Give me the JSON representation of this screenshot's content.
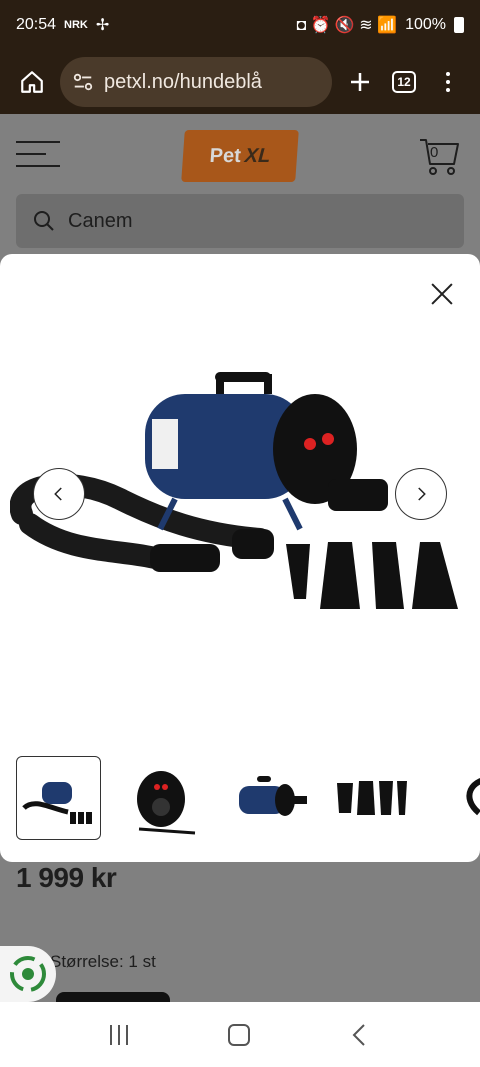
{
  "status": {
    "time": "20:54",
    "carrier": "NRK",
    "battery": "100%"
  },
  "browser": {
    "url": "petxl.no/hundeblå",
    "tabs_count": "12"
  },
  "site": {
    "logo_pet": "Pet",
    "logo_xl": "XL",
    "cart_count": "0",
    "search_value": "Canem",
    "price": "1 999 kr",
    "size_label": "Størrelse: 1 st"
  },
  "modal": {
    "thumbnails": [
      "dryer-with-accessories",
      "dryer-front",
      "dryer-side",
      "nozzles",
      "hose"
    ],
    "active_thumb": 0
  },
  "colors": {
    "chrome": "#2a1e12",
    "logo_orange": "#a8571a",
    "dryer_blue": "#1f3a6e"
  }
}
